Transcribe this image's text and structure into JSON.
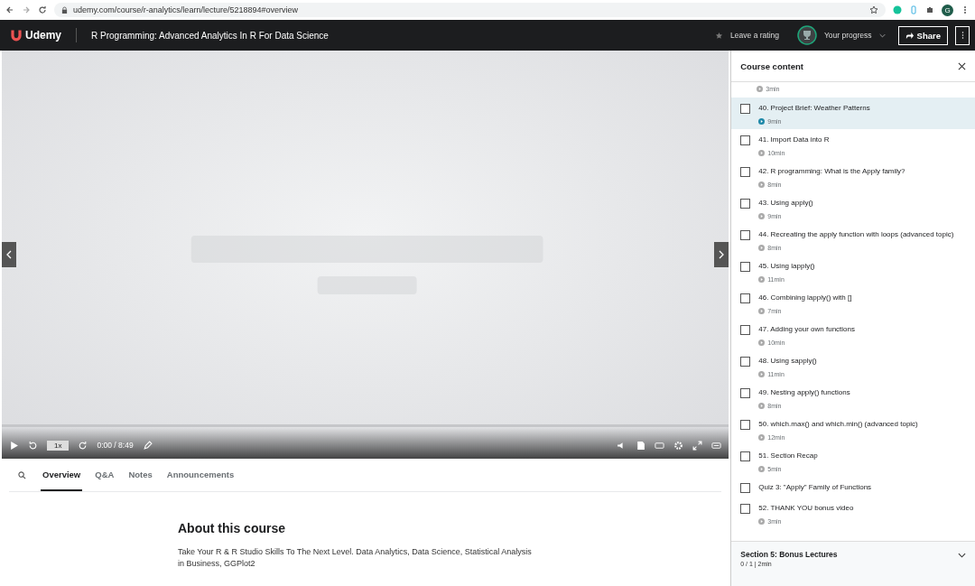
{
  "browser": {
    "url": "udemy.com/course/r-analytics/learn/lecture/5218894#overview",
    "profile_initial": "G"
  },
  "header": {
    "logo": "Udemy",
    "course_title": "R Programming: Advanced Analytics In R For Data Science",
    "rating_link": "Leave a rating",
    "progress_label": "Your progress",
    "share_button": "Share"
  },
  "player": {
    "speed": "1x",
    "time": "0:00 / 8:49"
  },
  "tabs": [
    {
      "label": "Overview",
      "selected": true
    },
    {
      "label": "Q&A",
      "selected": false
    },
    {
      "label": "Notes",
      "selected": false
    },
    {
      "label": "Announcements",
      "selected": false
    }
  ],
  "about": {
    "heading": "About this course",
    "text": "Take Your R & R Studio Skills To The Next Level. Data Analytics, Data Science, Statistical Analysis in Business, GGPlot2"
  },
  "sidebar": {
    "title": "Course content",
    "top_duration": "3min",
    "items": [
      {
        "kind": "lecture",
        "title": "40. Project Brief: Weather Patterns",
        "duration": "9min",
        "selected": true,
        "checked": false
      },
      {
        "kind": "lecture",
        "title": "41. Import Data into R",
        "duration": "10min",
        "selected": false,
        "checked": false
      },
      {
        "kind": "lecture",
        "title": "42. R programming: What is the Apply family?",
        "duration": "8min",
        "selected": false,
        "checked": false
      },
      {
        "kind": "lecture",
        "title": "43. Using apply()",
        "duration": "9min",
        "selected": false,
        "checked": false
      },
      {
        "kind": "lecture",
        "title": "44. Recreating the apply function with loops (advanced topic)",
        "duration": "8min",
        "selected": false,
        "checked": false
      },
      {
        "kind": "lecture",
        "title": "45. Using lapply()",
        "duration": "11min",
        "selected": false,
        "checked": false
      },
      {
        "kind": "lecture",
        "title": "46. Combining lapply() with []",
        "duration": "7min",
        "selected": false,
        "checked": false
      },
      {
        "kind": "lecture",
        "title": "47. Adding your own functions",
        "duration": "10min",
        "selected": false,
        "checked": false
      },
      {
        "kind": "lecture",
        "title": "48. Using sapply()",
        "duration": "11min",
        "selected": false,
        "checked": false
      },
      {
        "kind": "lecture",
        "title": "49. Nesting apply() functions",
        "duration": "8min",
        "selected": false,
        "checked": false
      },
      {
        "kind": "lecture",
        "title": "50. which.max() and which.min() (advanced topic)",
        "duration": "12min",
        "selected": false,
        "checked": false
      },
      {
        "kind": "lecture",
        "title": "51. Section Recap",
        "duration": "5min",
        "selected": false,
        "checked": false
      },
      {
        "kind": "quiz",
        "title": "Quiz 3: \"Apply\" Family of Functions",
        "selected": false,
        "checked": false
      },
      {
        "kind": "lecture",
        "title": "52. THANK YOU bonus video",
        "duration": "3min",
        "selected": false,
        "checked": false
      }
    ],
    "section": {
      "title": "Section 5: Bonus Lectures",
      "meta": "0 / 1 | 2min",
      "expanded": false
    }
  }
}
